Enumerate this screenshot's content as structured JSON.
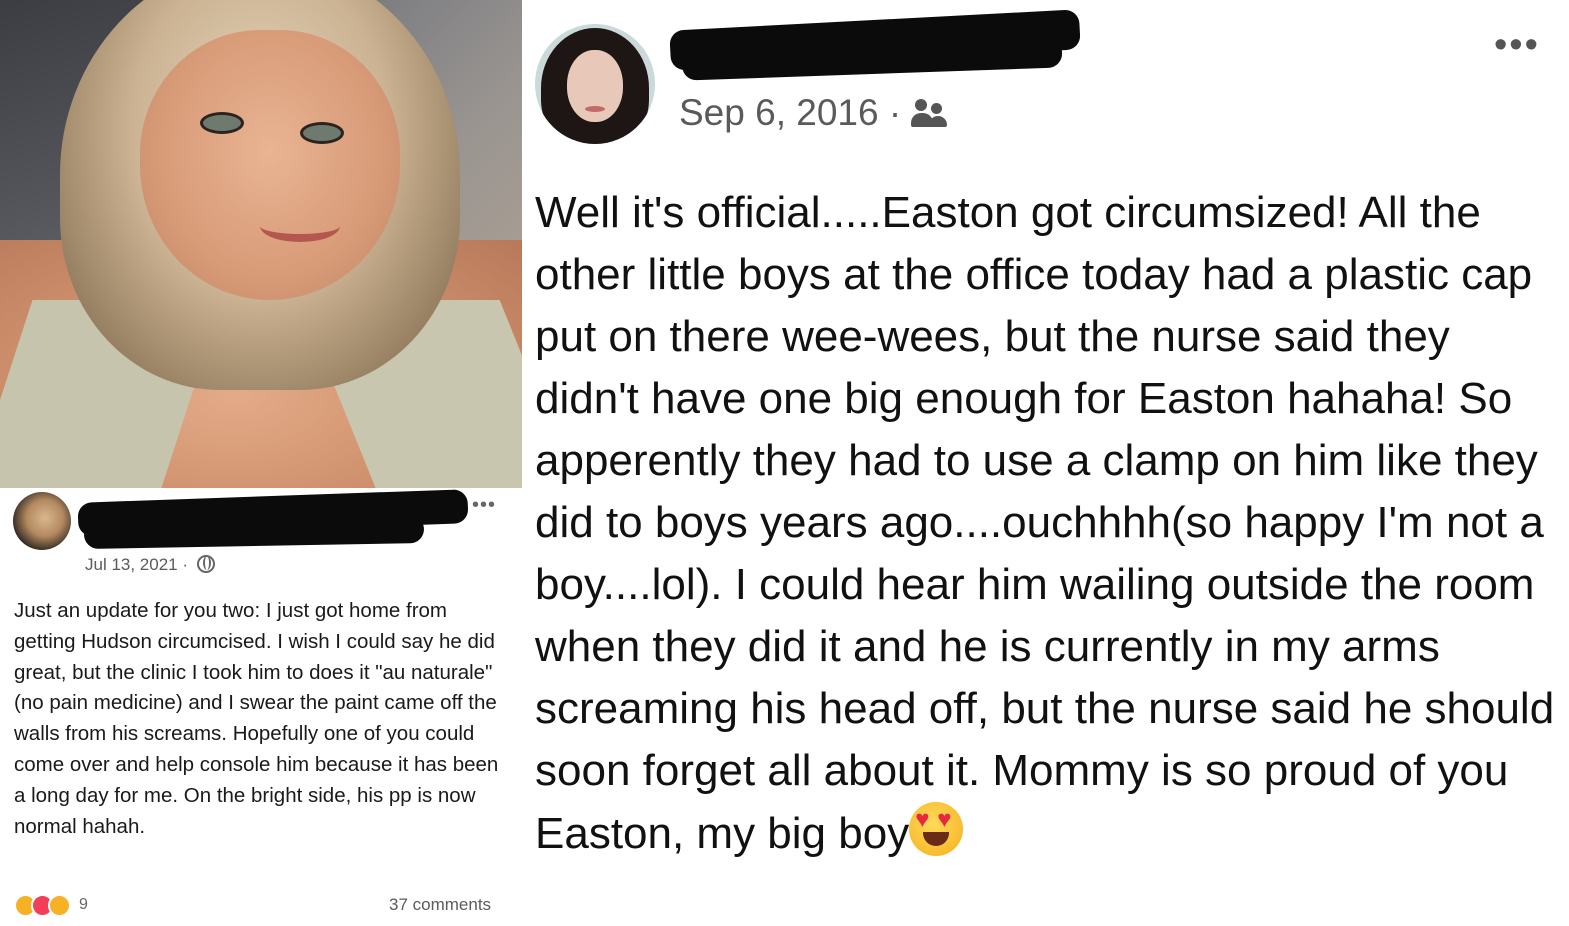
{
  "left_post": {
    "date": "Jul 13, 2021 ·",
    "text": "Just an update for you two: I just got home from getting Hudson circumcised. I wish I could say he did great, but the clinic I took him to does it \"au naturale\"(no pain medicine) and I swear the paint came off the walls from his screams. Hopefully one of you could come over and help console him because it has been a long day for me. On the bright side, his pp is now normal hahah.",
    "reaction_count": "9",
    "comments": "37 comments",
    "more": "•••",
    "icons": [
      "globe-icon",
      "care-reaction-icon",
      "love-reaction-icon",
      "sad-reaction-icon"
    ],
    "colors": {
      "love": "#f33e58",
      "care": "#f7b125"
    }
  },
  "right_post": {
    "date": "Sep 6, 2016 ·",
    "text": "Well it's official.....Easton got circumsized! All the other little boys at the office today had a plastic cap put on there wee-wees, but the nurse said they didn't have one big enough for Easton hahaha! So apperently they had to use a clamp on him like they did to boys years ago....ouchhhh(so happy I'm not a boy....lol). I could hear him wailing outside the room when they did it and he is currently in my arms screaming his head off, but the nurse said he should soon forget all about it. Mommy is so proud of you Easton, my big boy",
    "more": "•••",
    "icons": [
      "friends-icon",
      "heart-eyes-emoji-icon"
    ]
  }
}
